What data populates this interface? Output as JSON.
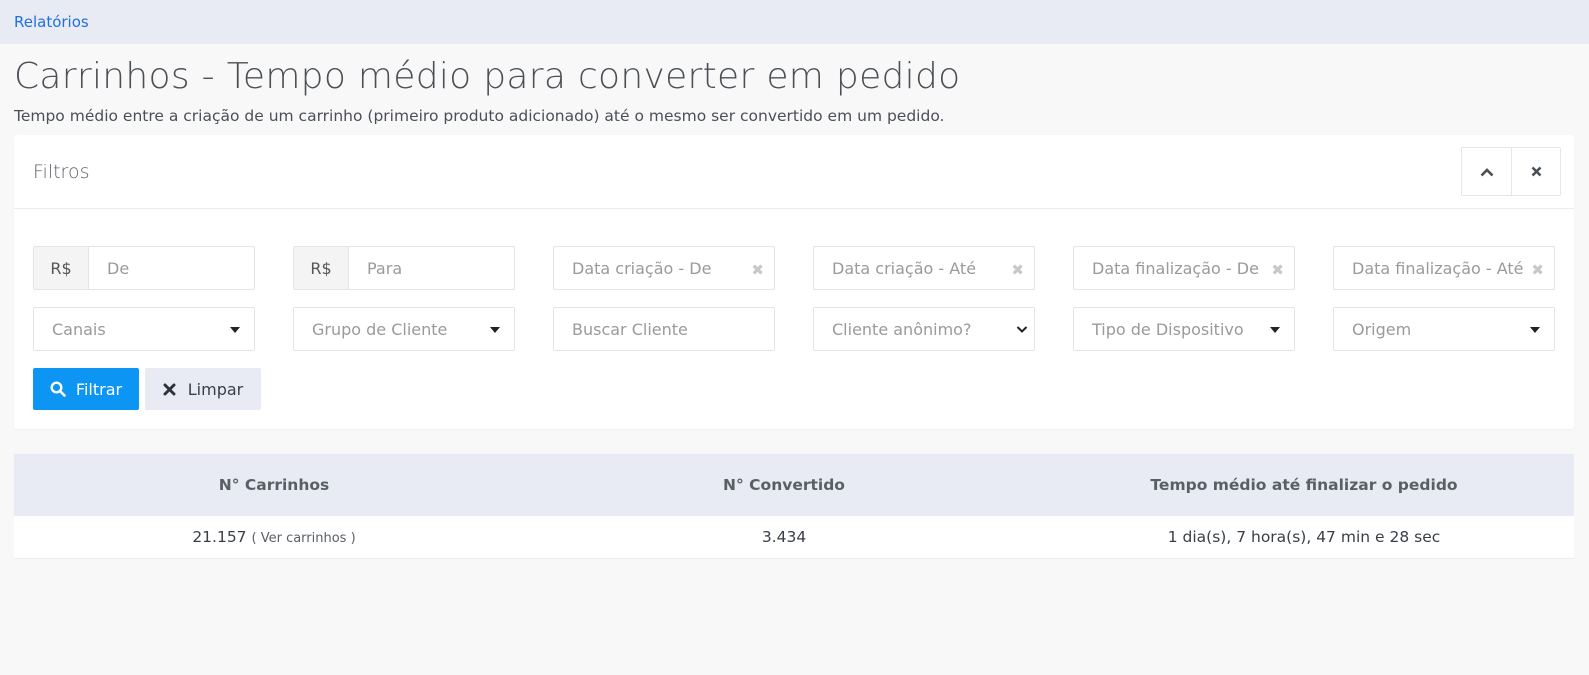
{
  "breadcrumb": {
    "link": "Relatórios"
  },
  "page": {
    "title": "Carrinhos - Tempo médio para converter em pedido",
    "description": "Tempo médio entre a criação de um carrinho (primeiro produto adicionado) até o mesmo ser convertido em um pedido."
  },
  "filters": {
    "title": "Filtros",
    "currency": "R$",
    "price_from": "De",
    "price_to": "Para",
    "created_from": "Data criação - De",
    "created_to": "Data criação - Até",
    "finished_from": "Data finalização - De",
    "finished_to": "Data finalização - Até",
    "channels": "Canais",
    "customer_group": "Grupo de Cliente",
    "search_customer": "Buscar Cliente",
    "anonymous_customer": "Cliente anônimo?",
    "device_type": "Tipo de Dispositivo",
    "origin": "Origem",
    "filter_button": "Filtrar",
    "clear_button": "Limpar"
  },
  "results": {
    "headers": [
      "N° Carrinhos",
      "N° Convertido",
      "Tempo médio até finalizar o pedido"
    ],
    "carts": "21.157",
    "view_carts": "( Ver carrinhos )",
    "converted": "3.434",
    "avg_time": "1 dia(s), 7 hora(s), 47 min e 28 sec"
  },
  "colors": {
    "primary": "#0d95f4",
    "header_bg": "#e8ebf3",
    "link": "#1f6fe5"
  }
}
